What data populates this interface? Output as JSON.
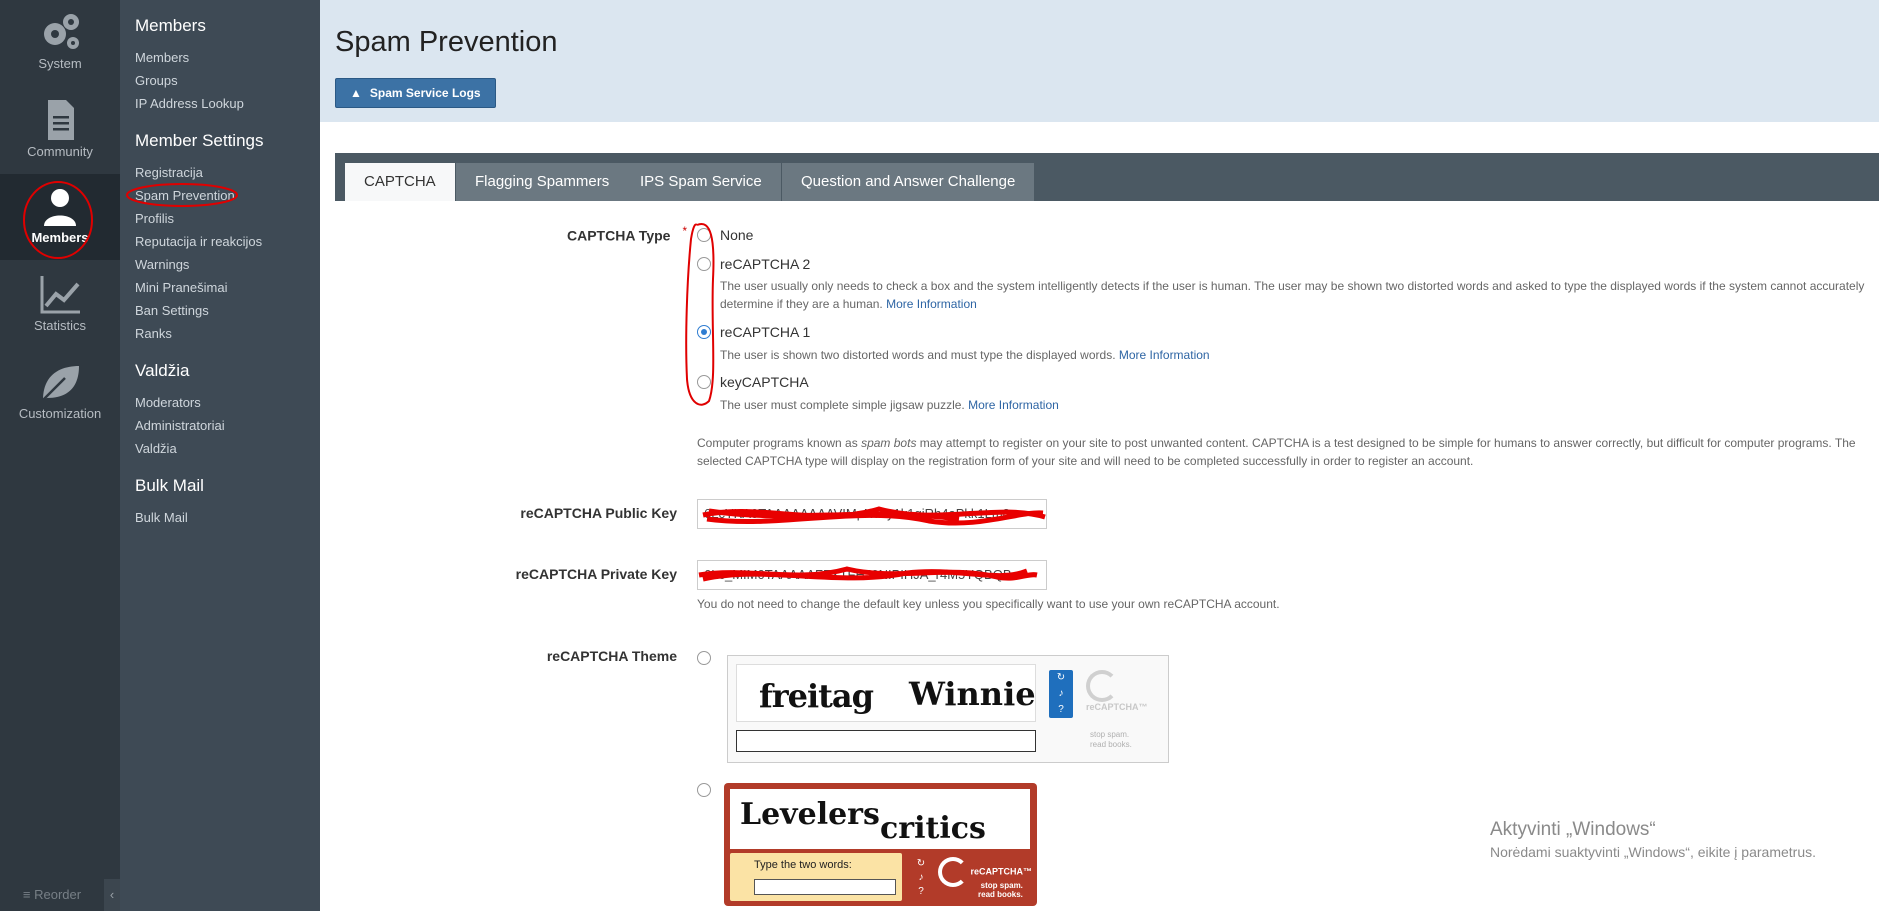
{
  "rail": {
    "items": [
      {
        "label": "System",
        "icon": "gears-icon"
      },
      {
        "label": "Community",
        "icon": "document-icon"
      },
      {
        "label": "Members",
        "icon": "user-icon"
      },
      {
        "label": "Statistics",
        "icon": "chart-icon"
      },
      {
        "label": "Customization",
        "icon": "leaf-icon"
      }
    ],
    "reorder": "≡ Reorder",
    "collapse": "‹"
  },
  "subnav": {
    "groups": [
      {
        "title": "Members",
        "links": [
          "Members",
          "Groups",
          "IP Address Lookup"
        ]
      },
      {
        "title": "Member Settings",
        "links": [
          "Registracija",
          "Spam Prevention",
          "Profilis",
          "Reputacija ir reakcijos",
          "Warnings",
          "Mini Pranešimai",
          "Ban Settings",
          "Ranks"
        ]
      },
      {
        "title": "Valdžia",
        "links": [
          "Moderators",
          "Administratoriai",
          "Valdžia"
        ]
      },
      {
        "title": "Bulk Mail",
        "links": [
          "Bulk Mail"
        ]
      }
    ]
  },
  "header": {
    "title": "Spam Prevention",
    "logs_button": "Spam Service Logs"
  },
  "tabs": [
    "CAPTCHA",
    "Flagging Spammers",
    "IPS Spam Service",
    "Question and Answer Challenge"
  ],
  "form": {
    "captcha_type_label": "CAPTCHA Type",
    "required_mark": "*",
    "options": [
      {
        "title": "None",
        "desc": "",
        "checked": false
      },
      {
        "title": "reCAPTCHA 2",
        "desc": "The user usually only needs to check a box and the system intelligently detects if the user is human. The user may be shown two distorted words and asked to type the displayed words if the system cannot accurately determine if they are a human.",
        "checked": false
      },
      {
        "title": "reCAPTCHA 1",
        "desc": "The user is shown two distorted words and must type the displayed words.",
        "checked": true
      },
      {
        "title": "keyCAPTCHA",
        "desc": "The user must complete simple jigsaw puzzle.",
        "checked": false
      }
    ],
    "more_info": "More Information",
    "explanation_part1": "Computer programs known as ",
    "explanation_em": "spam bots",
    "explanation_part2": " may attempt to register on your site to post unwanted content. CAPTCHA is a test designed to be simple for humans to answer correctly, but difficult for computer programs. The selected CAPTCHA type will display on the registration form of your site and will need to be completed successfully in order to register an account.",
    "public_key_label": "reCAPTCHA Public Key",
    "public_key_value": "6LcYKA0TAAAAAAAAVIMpN7cy1k1gjRh4aPkk1Lm8x",
    "private_key_label": "reCAPTCHA Private Key",
    "private_key_value": "6Lc_MIM0TAAAAAFFXTFHJ0NIPIHJA_r4M5YQBQB",
    "private_key_note": "You do not need to change the default key unless you specifically want to use your own reCAPTCHA account.",
    "theme_label": "reCAPTCHA Theme",
    "theme1": {
      "word1": "freitag",
      "word2": "Winnie",
      "brand": "reCAPTCHA™",
      "tagline1": "stop spam.",
      "tagline2": "read books."
    },
    "theme2": {
      "word1": "Levelers",
      "word2": "critics",
      "prompt": "Type the two words:",
      "brand": "reCAPTCHA™",
      "tagline1": "stop spam.",
      "tagline2": "read books."
    }
  },
  "watermark": {
    "title": "Aktyvinti „Windows“",
    "subtitle": "Norėdami suaktyvinti „Windows“, eikite į parametrus."
  }
}
